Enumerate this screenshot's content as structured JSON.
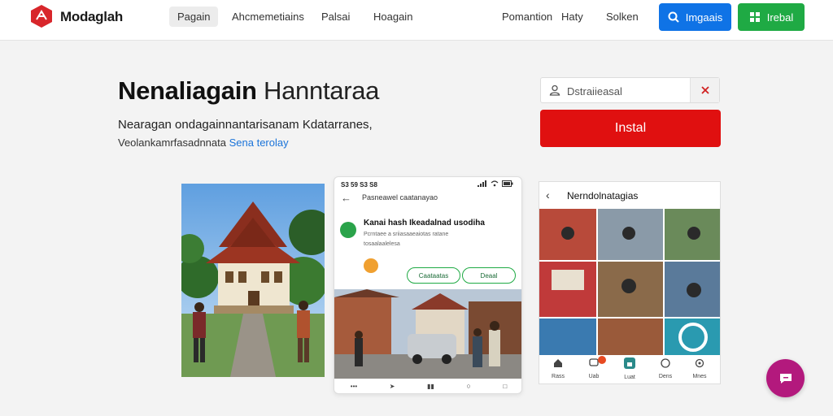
{
  "brand": {
    "name": "Modaglah"
  },
  "nav": {
    "items": [
      "Pagain",
      "Ahcmemetiains",
      "Palsai",
      "Hoagain"
    ],
    "active_index": 0,
    "right_items": [
      "Pomantion",
      "Haty",
      "Solken"
    ]
  },
  "top_buttons": {
    "blue_label": "Imgaais",
    "green_label": "Irebal"
  },
  "hero": {
    "title_bold": "Nenaliagain",
    "title_light": "Hanntaraa",
    "subtitle": "Nearagan ondagainnantarisanam Kdatarranes,",
    "tagline_prefix": "Veolankamrfasadnnata",
    "tagline_link": "Sena terolay"
  },
  "search": {
    "value": "Dstraiieasal",
    "placeholder": "Dstraiieasal"
  },
  "install_button": {
    "label": "Instal"
  },
  "phone": {
    "status_time": "S3 59 S3 S8",
    "header": "Pasneawel caatanayao",
    "post_title": "Kanai hash Ikeadalnad usodiha",
    "post_meta_1": "Pcrntaee a sriiasaaeaiotas ratane",
    "post_meta_2": "tosaalaalelesa",
    "follow_label": "Caataatas",
    "message_label": "Deaal"
  },
  "gallery": {
    "title": "Nerndolnatagias",
    "nav_labels": [
      "Rass",
      "Uab",
      "Luat",
      "Dens",
      "Mnes"
    ]
  },
  "colors": {
    "accent_blue": "#0f73e6",
    "accent_green": "#1faa44",
    "install_red": "#e01010",
    "chat_purple": "#b3197d"
  }
}
